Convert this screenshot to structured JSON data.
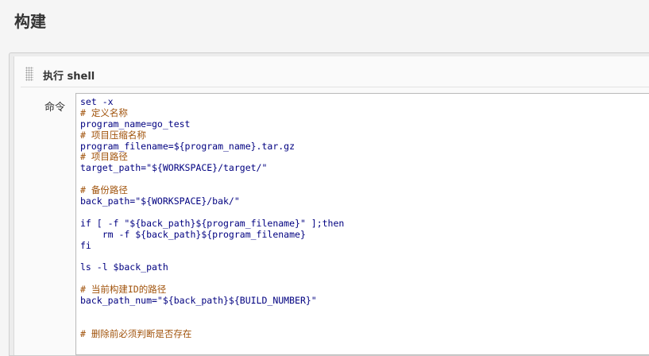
{
  "page": {
    "title": "构建"
  },
  "build_step": {
    "title": "执行 shell",
    "command_label": "命令"
  },
  "script": {
    "lines": [
      [
        {
          "t": "set -x",
          "c": "plain"
        }
      ],
      [
        {
          "t": "# 定义名称",
          "c": "comment"
        }
      ],
      [
        {
          "t": "program_name=go_test",
          "c": "plain"
        }
      ],
      [
        {
          "t": "# 项目压缩名称",
          "c": "comment"
        }
      ],
      [
        {
          "t": "program_filename=${program_name}.tar.gz",
          "c": "plain"
        }
      ],
      [
        {
          "t": "# 项目路径",
          "c": "comment"
        }
      ],
      [
        {
          "t": "target_path=\"${WORKSPACE}/target/\"",
          "c": "plain"
        }
      ],
      [
        {
          "t": "",
          "c": "plain"
        }
      ],
      [
        {
          "t": "# 备份路径",
          "c": "comment"
        }
      ],
      [
        {
          "t": "back_path=\"${WORKSPACE}/bak/\"",
          "c": "plain"
        }
      ],
      [
        {
          "t": "",
          "c": "plain"
        }
      ],
      [
        {
          "t": "if [ -f \"${back_path}${program_filename}\" ];then",
          "c": "plain"
        }
      ],
      [
        {
          "t": "    rm -f ${back_path}${program_filename}",
          "c": "plain"
        }
      ],
      [
        {
          "t": "fi",
          "c": "plain"
        }
      ],
      [
        {
          "t": "",
          "c": "plain"
        }
      ],
      [
        {
          "t": "ls -l $back_path",
          "c": "plain"
        }
      ],
      [
        {
          "t": "",
          "c": "plain"
        }
      ],
      [
        {
          "t": "# 当前构建ID的路径",
          "c": "comment"
        }
      ],
      [
        {
          "t": "back_path_num=\"${back_path}${BUILD_NUMBER}\"",
          "c": "plain"
        }
      ],
      [
        {
          "t": "",
          "c": "plain"
        }
      ],
      [
        {
          "t": "",
          "c": "plain"
        }
      ],
      [
        {
          "t": "# 删除前必须判断是否存在",
          "c": "comment"
        }
      ]
    ]
  },
  "colors": {
    "comment": "#a0520a",
    "plain": "#000080"
  }
}
